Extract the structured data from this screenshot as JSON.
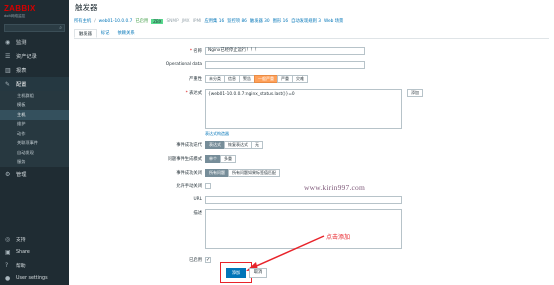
{
  "sidebar": {
    "brand": "ZABBIX",
    "subtitle": "dolt网络监控",
    "menu": [
      {
        "label": "监测",
        "icon": "eye-icon"
      },
      {
        "label": "资产记录",
        "icon": "list-icon"
      },
      {
        "label": "报表",
        "icon": "chart-icon"
      },
      {
        "label": "配置",
        "icon": "wrench-icon"
      }
    ],
    "config_items": [
      "主机群组",
      "模板",
      "主机",
      "维护",
      "动作",
      "关联项事件",
      "自动发现",
      "服务"
    ],
    "admin_label": "管理",
    "bottom": [
      {
        "label": "支持",
        "icon": "support-icon"
      },
      {
        "label": "Share",
        "icon": "share-icon"
      },
      {
        "label": "帮助",
        "icon": "help-icon"
      },
      {
        "label": "User settings",
        "icon": "user-icon"
      }
    ]
  },
  "header": {
    "title": "触发器",
    "breadcrumb": [
      "所有主机",
      "web01-10.0.0.7"
    ],
    "status": "已启用",
    "badges": [
      "ZBX",
      "SNMP",
      "JMX",
      "IPMI"
    ],
    "nav_links": [
      "应用集 16",
      "监控项 86",
      "触发器 30",
      "图形 16",
      "自动发现规则 3",
      "Web 场景"
    ]
  },
  "tabs": [
    "触发器",
    "标记",
    "依赖关系"
  ],
  "form": {
    "name_label": "名称",
    "name_value": "Nginx已经停止运行！！！",
    "opdata_label": "Operational data",
    "severity_label": "严重性",
    "severity_options": [
      "未分类",
      "信息",
      "警告",
      "一般严重",
      "严重",
      "灾难"
    ],
    "expression_label": "表达式",
    "expression_value": "{web01-10.0.0.7:nginx_status.last()}=0",
    "expression_add": "添加",
    "constructor_link": "表达式构造器",
    "event_gen_label": "事件成功迭代",
    "event_gen_options": [
      "表达式",
      "恢复表达式",
      "无"
    ],
    "problem_mode_label": "问题事件生成模式",
    "problem_mode_options": [
      "单个",
      "多重"
    ],
    "ok_close_label": "事件成功关闭",
    "ok_close_options": [
      "所有问题",
      "所有问题如果标签值匹配"
    ],
    "manual_close_label": "允许手动关闭",
    "url_label": "URL",
    "desc_label": "描述",
    "enabled_label": "已启用",
    "add_button": "添加",
    "cancel_button": "取消"
  },
  "overlay": {
    "watermark": "www.kirin997.com",
    "annotation": "点击添加"
  }
}
